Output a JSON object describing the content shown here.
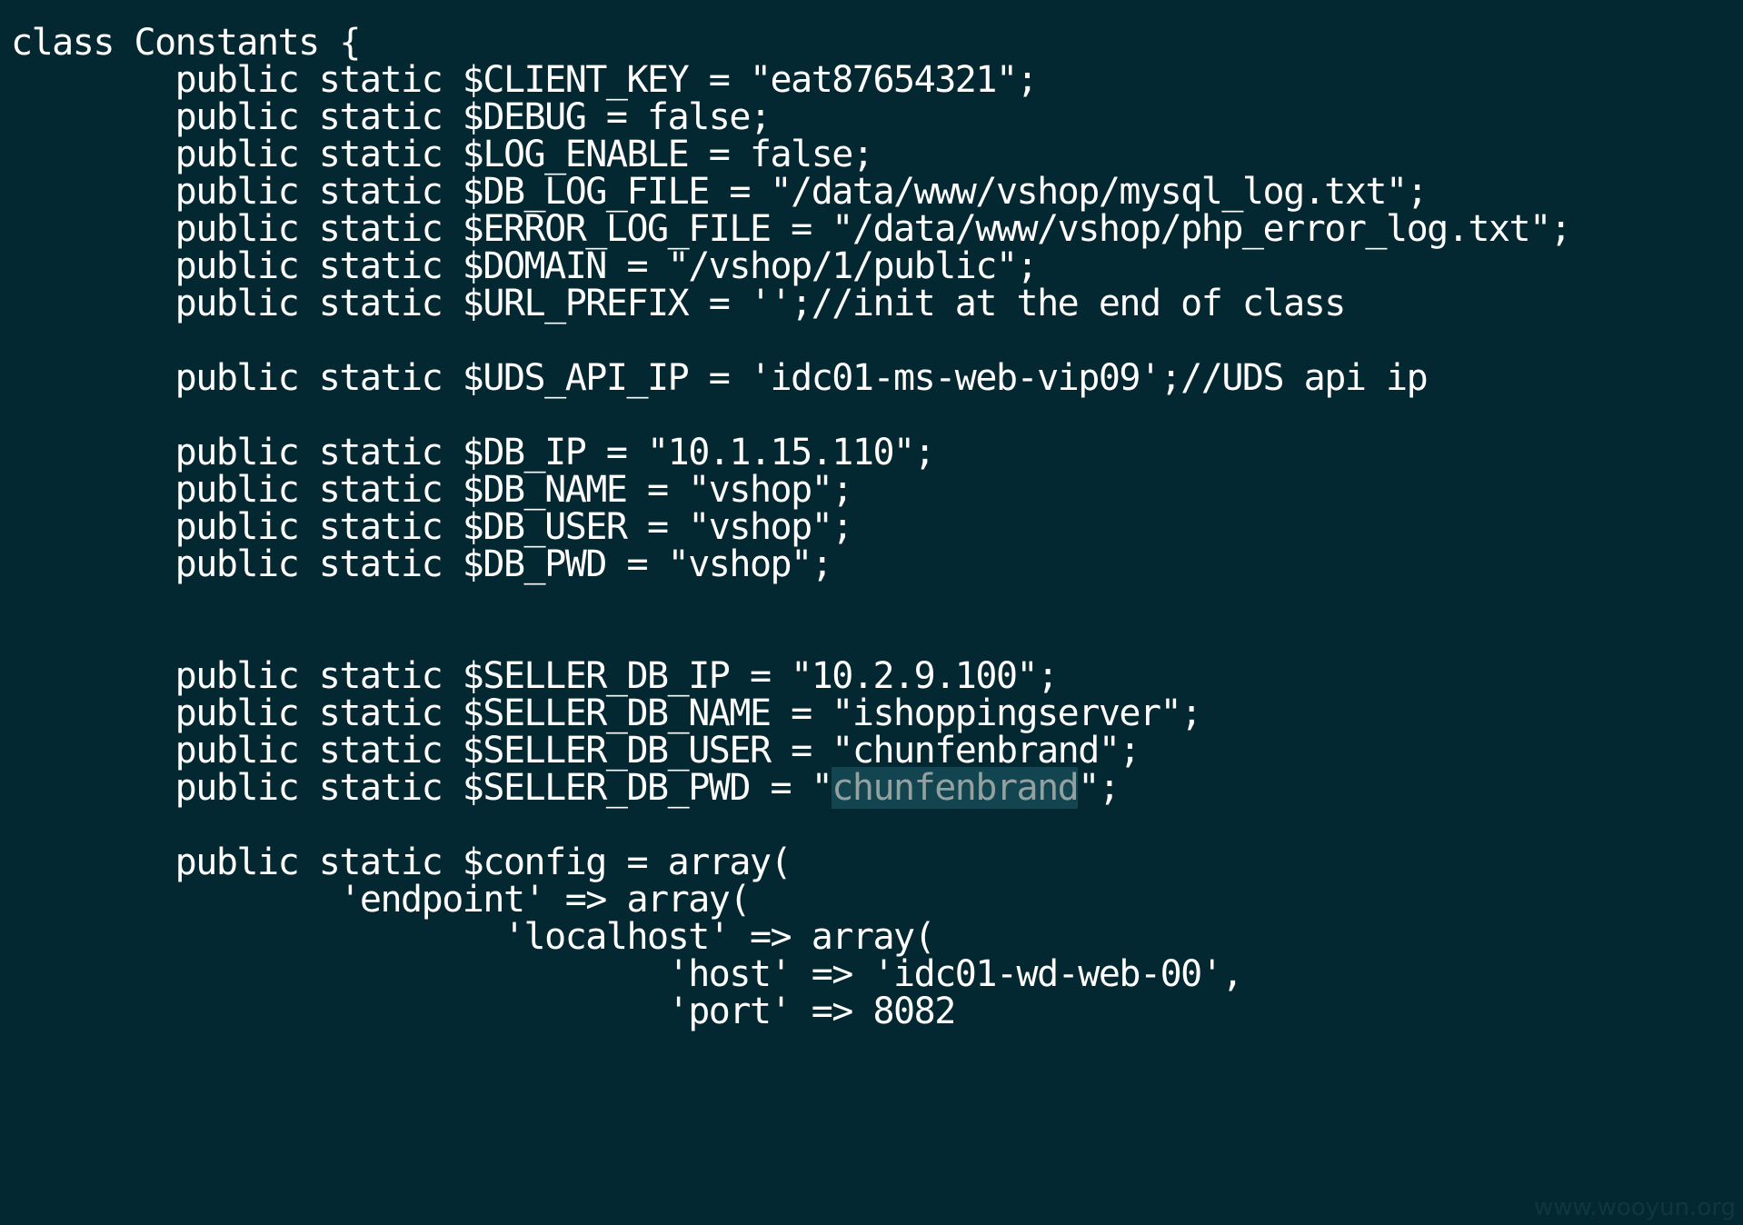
{
  "editor": {
    "background": "#042832",
    "text_color": "#ffffff",
    "selection_color": "#12454f",
    "lines": [
      "class Constants {",
      "        public static $CLIENT_KEY = \"eat87654321\";",
      "        public static $DEBUG = false;",
      "        public static $LOG_ENABLE = false;",
      "        public static $DB_LOG_FILE = \"/data/www/vshop/mysql_log.txt\";",
      "        public static $ERROR_LOG_FILE = \"/data/www/vshop/php_error_log.txt\";",
      "        public static $DOMAIN = \"/vshop/1/public\";",
      "        public static $URL_PREFIX = '';//init at the end of class",
      "",
      "        public static $UDS_API_IP = 'idc01-ms-web-vip09';//UDS api ip",
      "",
      "        public static $DB_IP = \"10.1.15.110\";",
      "        public static $DB_NAME = \"vshop\";",
      "        public static $DB_USER = \"vshop\";",
      "        public static $DB_PWD = \"vshop\";",
      "",
      "",
      "        public static $SELLER_DB_IP = \"10.2.9.100\";",
      "        public static $SELLER_DB_NAME = \"ishoppingserver\";",
      "        public static $SELLER_DB_USER = \"chunfenbrand\";",
      "",
      "",
      "        public static $config = array(",
      "                'endpoint' => array(",
      "                        'localhost' => array(",
      "                                'host' => 'idc01-wd-web-00',",
      "                                'port' => 8082"
    ],
    "selected_line": {
      "before": "        public static $SELLER_DB_PWD = \"",
      "selected": "chunfenbrand",
      "after": "\";"
    }
  },
  "watermark": "www.wooyun.org"
}
